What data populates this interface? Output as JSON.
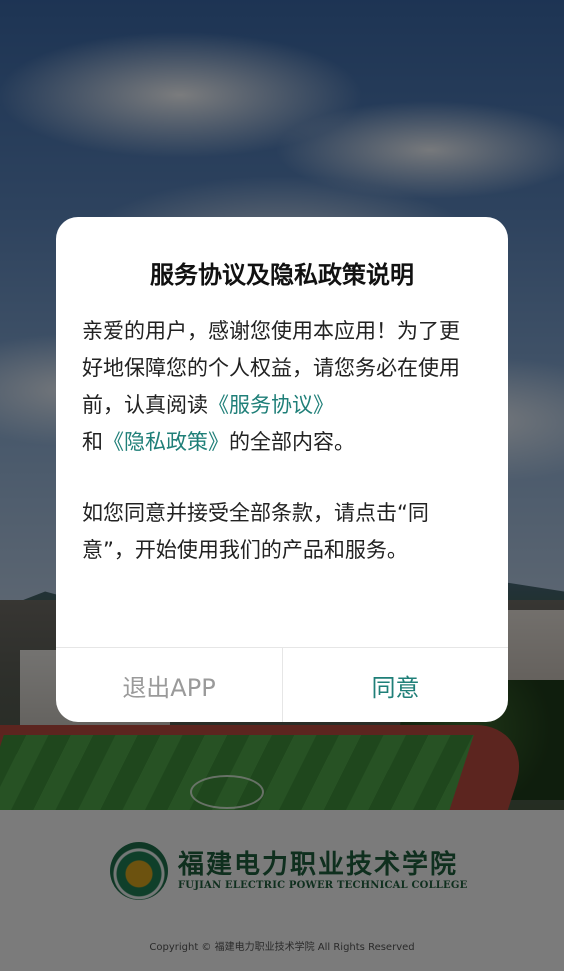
{
  "dialog": {
    "title": "服务协议及隐私政策说明",
    "para1_before": "亲爱的用户，感谢您使用本应用！为了更好地保障您的个人权益，请您务必在使用前，认真阅读",
    "service_link": "《服务协议》",
    "para1_and": "和",
    "privacy_link": "《隐私政策》",
    "para1_after": "的全部内容。",
    "para2": "如您同意并接受全部条款，请点击“同意”，开始使用我们的产品和服务。",
    "exit_label": "退出APP",
    "agree_label": "同意"
  },
  "branding": {
    "logo_cn": "福建电力职业技术学院",
    "logo_en": "FUJIAN ELECTRIC POWER TECHNICAL COLLEGE",
    "copyright": "Copyright © 福建电力职业技术学院 All Rights Reserved"
  },
  "colors": {
    "link": "#1f7f78",
    "exit_text": "#9a9a9a",
    "scrim": "rgba(0,0,0,0.5)"
  }
}
